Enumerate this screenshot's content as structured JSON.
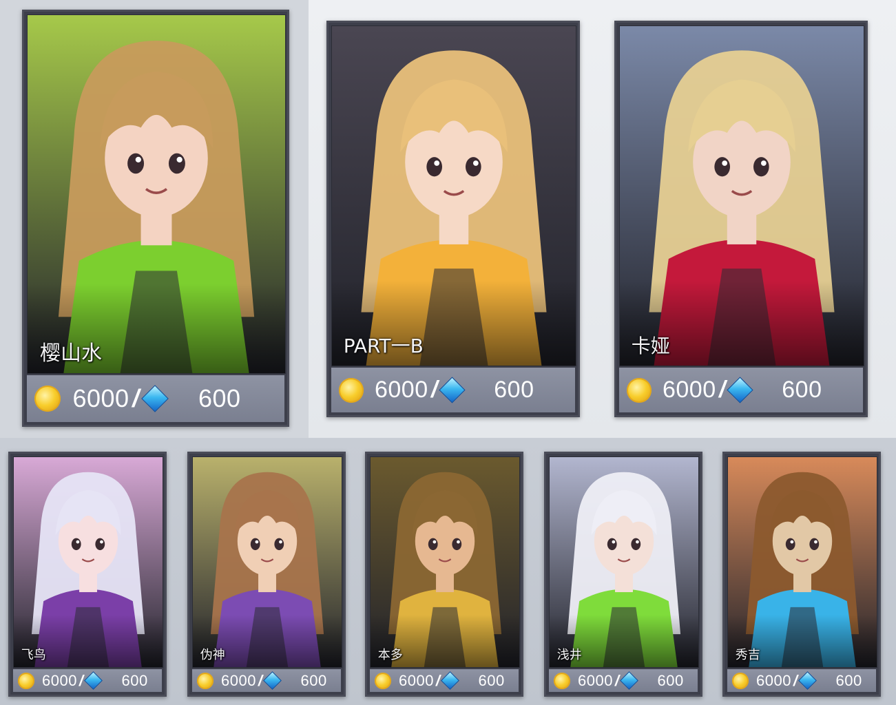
{
  "currency": {
    "gold_icon": "gold-coin-icon",
    "gem_icon": "blue-diamond-icon",
    "separator": "/"
  },
  "featured": [
    {
      "name": "樱山水",
      "gold": "6000",
      "gem": "600",
      "bg": "#a6c94a",
      "skin": "#f4d3c2",
      "hair": "#c79b5c",
      "accent": "#7ccf2f"
    },
    {
      "name": "PART一B",
      "gold": "6000",
      "gem": "600",
      "bg": "#4a4652",
      "skin": "#f6d9c6",
      "hair": "#e9c07a",
      "accent": "#f3b13a"
    },
    {
      "name": "卡娅",
      "gold": "6000",
      "gem": "600",
      "bg": "#7b89a8",
      "skin": "#f1d4c6",
      "hair": "#e6cf92",
      "accent": "#c4193b"
    }
  ],
  "heroes": [
    {
      "name": "飞鸟",
      "gold": "6000",
      "gem": "600",
      "bg": "#d8a9d6",
      "skin": "#f7dfe0",
      "hair": "#e6e4f5",
      "accent": "#7b3fa8"
    },
    {
      "name": "伪神",
      "gold": "6000",
      "gem": "600",
      "bg": "#b9b16c",
      "skin": "#f0cfb5",
      "hair": "#a8744c",
      "accent": "#7c4cb3"
    },
    {
      "name": "本多",
      "gold": "6000",
      "gem": "600",
      "bg": "#6b5a2e",
      "skin": "#e6b891",
      "hair": "#8b6733",
      "accent": "#e0b33f"
    },
    {
      "name": "浅井",
      "gold": "6000",
      "gem": "600",
      "bg": "#b2b6cf",
      "skin": "#f4e0d8",
      "hair": "#eeeef6",
      "accent": "#7fdc3b"
    },
    {
      "name": "秀吉",
      "gold": "6000",
      "gem": "600",
      "bg": "#d88a5a",
      "skin": "#e2c8a6",
      "hair": "#8c5a2e",
      "accent": "#39b3e8"
    }
  ]
}
